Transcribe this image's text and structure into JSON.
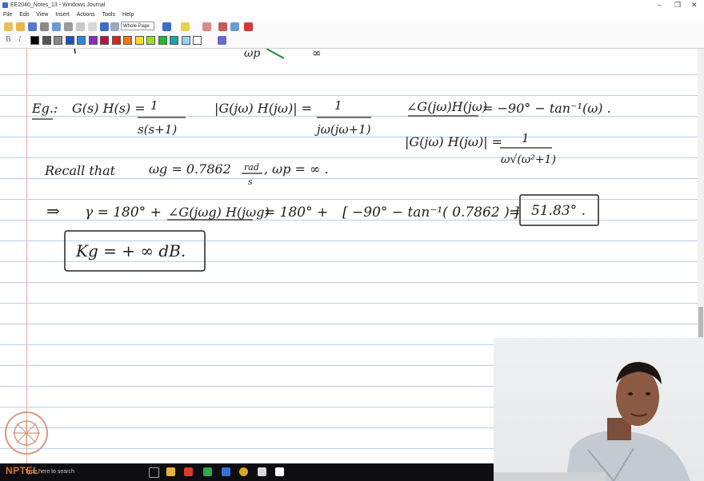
{
  "window": {
    "title": "EE2040_Notes_13 - Windows Journal",
    "controls": {
      "minimize": "–",
      "maximize": "❐",
      "close": "✕"
    }
  },
  "menu": [
    "File",
    "Edit",
    "View",
    "Insert",
    "Actions",
    "Tools",
    "Help"
  ],
  "toolbar": {
    "zoom_value": "Whole Page"
  },
  "format_bar": {
    "bold": "B",
    "italic": "I"
  },
  "palette": [
    "#000000",
    "#555555",
    "#888888",
    "#1f4fc4",
    "#2a86e8",
    "#8a2bc4",
    "#c0103c",
    "#e02020",
    "#f07a10",
    "#f2e41a",
    "#9fdc2a",
    "#1fba30",
    "#15a8a8",
    "#9ad0f5",
    "#ffffff"
  ],
  "notes": {
    "top_fragment_1": "ωp",
    "top_fragment_2": "∞",
    "eg_label": "Eg.:",
    "g_h": "G(s) H(s)  =",
    "tf_num": "1",
    "tf_den": "s(s+1)",
    "mag_lhs": "|G(jω) H(jω)|  =",
    "mag_num": "1",
    "mag_den": "jω(jω+1)",
    "phase_lhs": "∠G(jω)H(jω)",
    "phase_rhs": "=  −90°  − tan⁻¹(ω) .",
    "abs_lhs": "|G(jω) H(jω)|  =",
    "abs_num": "1",
    "abs_den": "ω√(ω²+1)",
    "recall": "Recall that",
    "wg": "ωg  =  0.7862",
    "rad_num": "rad",
    "rad_den": "s",
    "wp": ", ωp = ∞ .",
    "implies": "⇒",
    "gamma": "γ  =  180°  +",
    "gamma_angle": "∠G(jωg) H(jωg)",
    "eq1": "=   180°  +",
    "bracket": "[ −90° − tan⁻¹( 0.7862 ) ]",
    "eq2": "=",
    "result": "51.83° .",
    "kg": "Kg  =  + ∞  dB."
  },
  "taskbar": {
    "search_text": "Type here to search",
    "watermark": "NPTEL"
  }
}
